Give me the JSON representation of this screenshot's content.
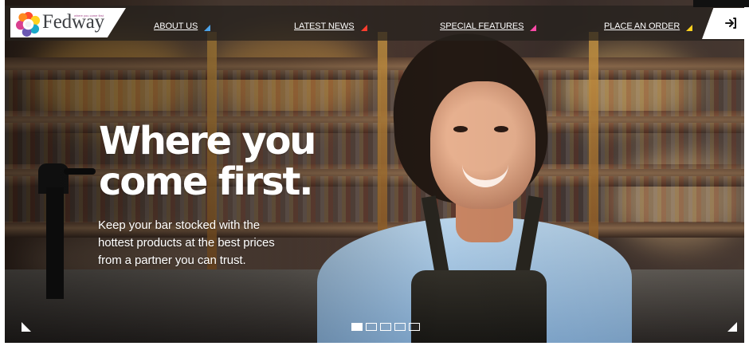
{
  "brand": {
    "name": "Fedway",
    "tagline": "where you come first",
    "colors": {
      "nav_about": "#4da3e8",
      "nav_latest": "#ff3d2e",
      "nav_features": "#ff4aa8",
      "nav_order": "#ffd21f",
      "logo_text": "#3d3f43"
    }
  },
  "nav": {
    "items": [
      {
        "label": "ABOUT US",
        "marker": "triangle-marker"
      },
      {
        "label": "LATEST NEWS",
        "marker": "triangle-marker"
      },
      {
        "label": "SPECIAL FEATURES",
        "marker": "triangle-marker"
      },
      {
        "label": "PLACE AN ORDER",
        "marker": "triangle-marker"
      }
    ],
    "login_icon": "login-icon"
  },
  "hero": {
    "headline": "Where you\ncome first.",
    "subheadline": "Keep your bar stocked with the\nhottest products at the best prices\nfrom a partner you can trust.",
    "slider": {
      "total_slides": 5,
      "active_slide": 1
    },
    "controls": {
      "previous_icon": "previous-slide-icon",
      "next_icon": "next-slide-icon"
    }
  }
}
